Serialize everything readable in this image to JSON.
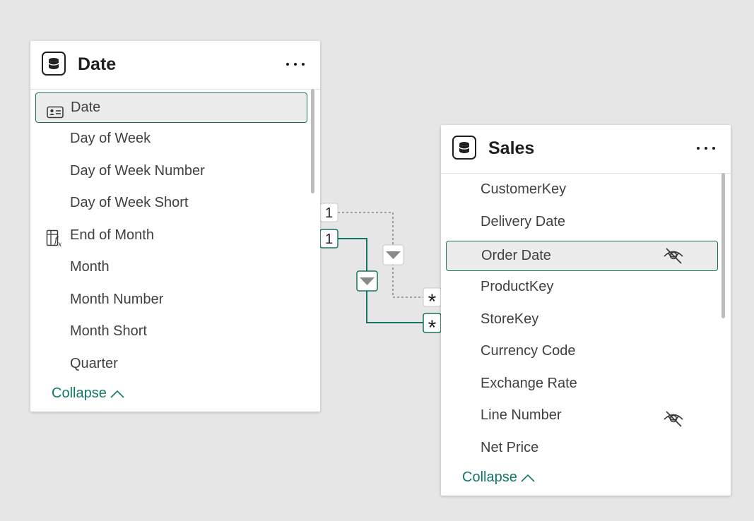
{
  "tables": {
    "date": {
      "title": "Date",
      "fields": [
        {
          "label": "Date",
          "icon": "key-card-icon"
        },
        {
          "label": "Day of Week"
        },
        {
          "label": "Day of Week Number"
        },
        {
          "label": "Day of Week Short"
        },
        {
          "label": "End of Month",
          "icon": "calculated-column-icon"
        },
        {
          "label": "Month"
        },
        {
          "label": "Month Number"
        },
        {
          "label": "Month Short"
        },
        {
          "label": "Quarter"
        }
      ],
      "collapse_label": "Collapse"
    },
    "sales": {
      "title": "Sales",
      "fields": [
        {
          "label": "CustomerKey"
        },
        {
          "label": "Delivery Date"
        },
        {
          "label": "Order Date",
          "icon": "hidden-eye-icon"
        },
        {
          "label": "ProductKey"
        },
        {
          "label": "StoreKey"
        },
        {
          "label": "Currency Code"
        },
        {
          "label": "Exchange Rate"
        },
        {
          "label": "Line Number",
          "icon": "hidden-eye-icon"
        },
        {
          "label": "Net Price"
        }
      ],
      "collapse_label": "Collapse"
    }
  },
  "relationships": [
    {
      "from_cardinality": "1",
      "to_cardinality": "*",
      "state": "inactive"
    },
    {
      "from_cardinality": "1",
      "to_cardinality": "*",
      "state": "active"
    }
  ],
  "colors": {
    "accent": "#137560",
    "inactive_line": "#8a8a8a",
    "canvas": "#e6e6e6"
  }
}
